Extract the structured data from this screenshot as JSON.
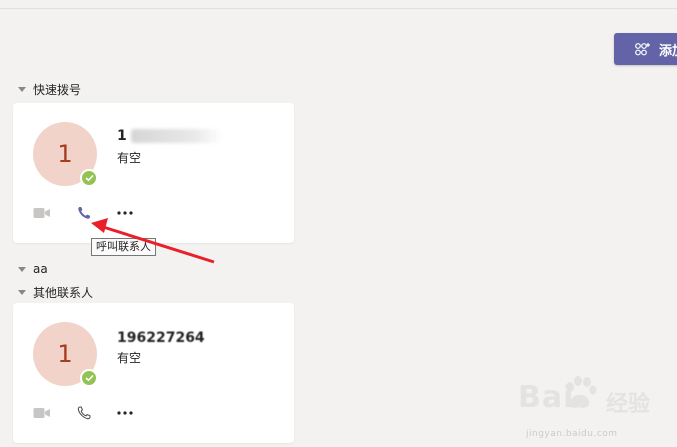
{
  "toolbar": {
    "add_label": "添加"
  },
  "groups": [
    {
      "name": "快速拨号"
    },
    {
      "name": "aa"
    },
    {
      "name": "其他联系人"
    }
  ],
  "speed_dial_card": {
    "avatar_initial": "1",
    "name_visible": "1",
    "status": "有空"
  },
  "other_contact_card": {
    "avatar_initial": "1",
    "name_visible": "196227264",
    "status": "有空"
  },
  "tooltip": {
    "call_contact": "呼叫联系人"
  },
  "watermark": {
    "logo": "Bai",
    "text": "经验",
    "url": "jingyan.baidu.com"
  },
  "colors": {
    "accent": "#6264a7",
    "presence_available": "#92c353",
    "avatar_bg": "#f1d3c9",
    "avatar_text": "#a33d1d",
    "annotation_arrow": "#e8202a"
  },
  "icons": {
    "add_people": "add-people-icon",
    "video": "video-icon",
    "call": "phone-icon",
    "more": "more-icon",
    "presence": "check-icon"
  }
}
